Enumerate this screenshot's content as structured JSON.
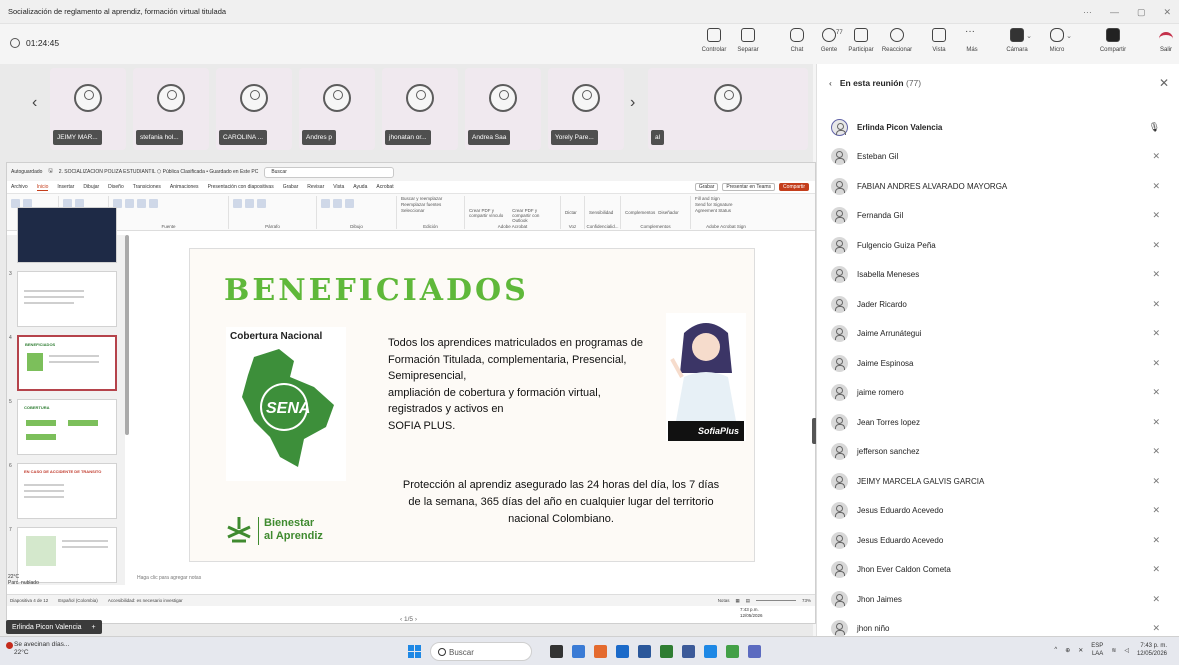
{
  "window": {
    "title": "Socialización de reglamento al aprendiz, formación virtual titulada"
  },
  "meeting": {
    "timer": "01:24:45",
    "toolbar": {
      "controlar": "Controlar",
      "separar": "Separar",
      "chat": "Chat",
      "gente": "Gente",
      "gente_count": "77",
      "participar": "Participar",
      "reaccionar": "Reaccionar",
      "vista": "Vista",
      "mas": "Más",
      "camara": "Cámara",
      "micro": "Micro",
      "compartir": "Compartir",
      "salir": "Salir"
    },
    "participants_strip": [
      "JEIMY MAR...",
      "stefania hol...",
      "CAROLINA ...",
      "Andres p",
      "jhonatan or...",
      "Andrea Saa",
      "Yorely Pare...",
      "al"
    ],
    "presenter_name": "Erlinda Picon Valencia",
    "page_indicator": "1/5"
  },
  "powerpoint": {
    "autosave": "Autoguardado",
    "filename": "2. SOCIALIZACION POLIZA ESTUDIANTIL ⬡ Pública Clasificada • Guardado en Este PC",
    "search": "Buscar",
    "menu": [
      "Archivo",
      "Inicio",
      "Insertar",
      "Dibujar",
      "Diseño",
      "Transiciones",
      "Animaciones",
      "Presentación con diapositivas",
      "Grabar",
      "Revisar",
      "Vista",
      "Ayuda",
      "Acrobat"
    ],
    "menu_right": [
      "Grabar",
      "Presentar en Teams",
      "Compartir"
    ],
    "ribbon_groups": [
      "Portapapeles",
      "Diapositivas",
      "Fuente",
      "Párrafo",
      "Dibujo",
      "Edición",
      "Adobe Acrobat",
      "Voz",
      "Confidencialid...",
      "Complementos",
      "Adobe Acrobat Sign"
    ],
    "ribbon_items": [
      "Buscar y reemplazar",
      "Reemplazar fuentes",
      "Seleccionar",
      "Crear PDF y compartir vínculo",
      "Crear PDF y compartir con Outlook",
      "Dictar",
      "Sensibilidad",
      "Complementos",
      "Diseñador",
      "Fill and Sign",
      "Send for Signature",
      "Agreement Status"
    ],
    "slide": {
      "title": "BENEFICIADOS",
      "map_label": "Cobertura Nacional",
      "map_logo": "SENA",
      "body_lines": [
        "Todos los aprendices matriculados en programas de",
        "Formación Titulada, complementaria, Presencial,",
        "Semipresencial,",
        "ampliación de cobertura y formación virtual,",
        "registrados y activos en",
        "SOFIA PLUS."
      ],
      "protection": "Protección al aprendiz asegurado las 24 horas del día, los 7 días de la semana, 365 días del año en cualquier lugar del territorio nacional Colombiano.",
      "sofia_badge": "SofiaPlus",
      "bienestar_line1": "Bienestar",
      "bienestar_line2": "al Aprendiz"
    },
    "thumbnails": [
      {
        "num": "3",
        "title": "",
        "selected": false
      },
      {
        "num": "4",
        "title": "BENEFICIADOS",
        "selected": true
      },
      {
        "num": "5",
        "title": "COBERTURA",
        "selected": false
      },
      {
        "num": "6",
        "title": "EN CASO DE ACCIDENTE DE TRANSITO",
        "selected": false
      },
      {
        "num": "7",
        "title": "",
        "selected": false
      }
    ],
    "notes_placeholder": "Haga clic para agregar notas",
    "status_left": "Diapositiva 4 de 12",
    "language": "Español (Colombia)",
    "accessibility": "Accesibilidad: es necesario investigar",
    "notes_btn": "Notas",
    "zoom": "73%",
    "weather_temp": "22°C",
    "weather_desc": "Parc. nublado",
    "mini_time": "7:43 p.m.",
    "mini_date": "12/05/2026"
  },
  "panel": {
    "title": "En esta reunión",
    "count": "(77)",
    "people": [
      {
        "name": "Erlinda Picon Valencia",
        "mic": "on"
      },
      {
        "name": "Esteban Gil",
        "mic": "muted"
      },
      {
        "name": "FABIAN ANDRES ALVARADO MAYORGA",
        "mic": "muted"
      },
      {
        "name": "Fernanda Gil",
        "mic": "muted"
      },
      {
        "name": "Fulgencio Guiza Peña",
        "mic": "muted"
      },
      {
        "name": "Isabella Meneses",
        "mic": "muted"
      },
      {
        "name": "Jader Ricardo",
        "mic": "muted"
      },
      {
        "name": "Jaime Arrunátegui",
        "mic": "muted"
      },
      {
        "name": "Jaime Espinosa",
        "mic": "muted"
      },
      {
        "name": "jaime romero",
        "mic": "muted"
      },
      {
        "name": "Jean Torres lopez",
        "mic": "muted"
      },
      {
        "name": "jefferson sanchez",
        "mic": "muted"
      },
      {
        "name": "JEIMY MARCELA GALVIS GARCIA",
        "mic": "muted"
      },
      {
        "name": "Jesus Eduardo Acevedo",
        "mic": "muted"
      },
      {
        "name": "Jesus Eduardo Acevedo",
        "mic": "muted"
      },
      {
        "name": "Jhon Ever Caldon Cometa",
        "mic": "muted"
      },
      {
        "name": "Jhon Jaimes",
        "mic": "muted"
      },
      {
        "name": "jhon niño",
        "mic": "muted"
      }
    ]
  },
  "taskbar": {
    "weather_line1": "Se avecinan días...",
    "weather_line2": "22°C",
    "search": "Buscar",
    "lang": "ESP",
    "lang2": "LAA",
    "time": "7:43 p. m.",
    "date": "12/05/2026"
  },
  "colors": {
    "accent": "#6264a7",
    "slide_green": "#5fb83a",
    "ppt_red": "#c43e1c",
    "leave_red": "#c4314b"
  }
}
